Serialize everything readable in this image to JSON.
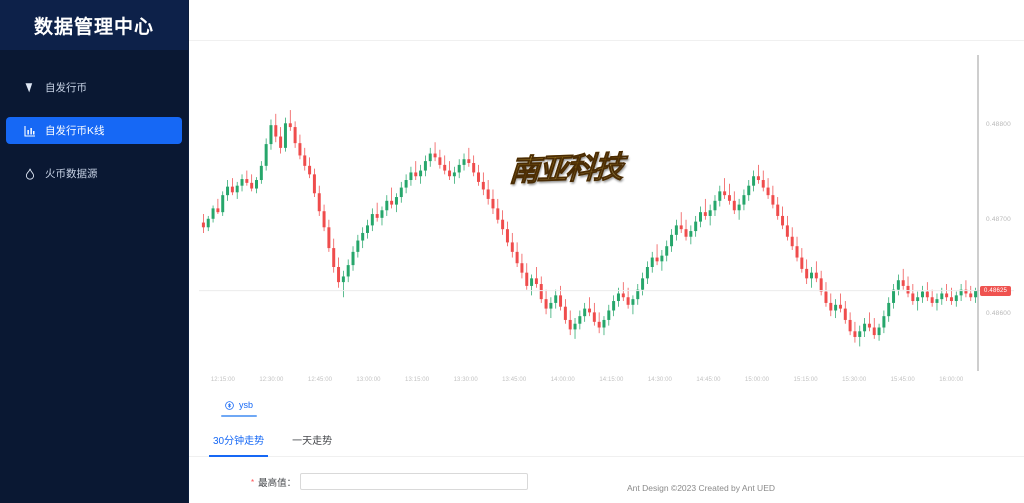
{
  "sidebar": {
    "title": "数据管理中心",
    "items": [
      {
        "label": "自发行币",
        "icon": "tag-icon",
        "active": false
      },
      {
        "label": "自发行币K线",
        "icon": "line-chart-icon",
        "active": true
      },
      {
        "label": "火币数据源",
        "icon": "fire-icon",
        "active": false
      }
    ]
  },
  "chart": {
    "watermark": "南亚科技",
    "current_price_tag": "0.48625",
    "y_labels": [
      "0.48800",
      "0.48700",
      "0.48600"
    ],
    "x_labels": [
      "12:15:00",
      "12:30:00",
      "12:45:00",
      "13:00:00",
      "13:15:00",
      "13:30:00",
      "13:45:00",
      "14:00:00",
      "14:15:00",
      "14:30:00",
      "14:45:00",
      "15:00:00",
      "15:15:00",
      "15:30:00",
      "15:45:00",
      "16:00:00"
    ]
  },
  "chart_data": {
    "type": "candlestick",
    "title": "",
    "xlabel": "",
    "ylabel": "",
    "ylim": [
      0.4854,
      0.4887
    ],
    "xlim": [
      "12:15:00",
      "16:12:00"
    ],
    "grid": false,
    "legend": "none",
    "up_color": "#26a66b",
    "down_color": "#ef4c4c",
    "y_ticks": [
      0.488,
      0.487,
      0.486
    ],
    "x_ticks": [
      "12:15:00",
      "12:30:00",
      "12:45:00",
      "13:00:00",
      "13:15:00",
      "13:30:00",
      "13:45:00",
      "14:00:00",
      "14:15:00",
      "14:30:00",
      "14:45:00",
      "15:00:00",
      "15:15:00",
      "15:30:00",
      "15:45:00",
      "16:00:00"
    ],
    "marker_price": 0.48625,
    "candles": [
      {
        "o": 0.48697,
        "h": 0.48706,
        "l": 0.48686,
        "c": 0.48692
      },
      {
        "o": 0.48692,
        "h": 0.48704,
        "l": 0.48688,
        "c": 0.48701
      },
      {
        "o": 0.48701,
        "h": 0.48715,
        "l": 0.48697,
        "c": 0.48712
      },
      {
        "o": 0.48712,
        "h": 0.48722,
        "l": 0.48706,
        "c": 0.48708
      },
      {
        "o": 0.48708,
        "h": 0.4873,
        "l": 0.48704,
        "c": 0.48726
      },
      {
        "o": 0.48726,
        "h": 0.48742,
        "l": 0.4872,
        "c": 0.48735
      },
      {
        "o": 0.48735,
        "h": 0.48744,
        "l": 0.48726,
        "c": 0.48729
      },
      {
        "o": 0.48729,
        "h": 0.4874,
        "l": 0.48722,
        "c": 0.48736
      },
      {
        "o": 0.48736,
        "h": 0.48748,
        "l": 0.4873,
        "c": 0.48743
      },
      {
        "o": 0.48743,
        "h": 0.48752,
        "l": 0.48736,
        "c": 0.48739
      },
      {
        "o": 0.48739,
        "h": 0.48748,
        "l": 0.4873,
        "c": 0.48733
      },
      {
        "o": 0.48733,
        "h": 0.48745,
        "l": 0.48728,
        "c": 0.48742
      },
      {
        "o": 0.48742,
        "h": 0.48762,
        "l": 0.48738,
        "c": 0.48757
      },
      {
        "o": 0.48757,
        "h": 0.48786,
        "l": 0.48752,
        "c": 0.4878
      },
      {
        "o": 0.4878,
        "h": 0.48806,
        "l": 0.48774,
        "c": 0.488
      },
      {
        "o": 0.488,
        "h": 0.48812,
        "l": 0.48782,
        "c": 0.48788
      },
      {
        "o": 0.48788,
        "h": 0.48798,
        "l": 0.4877,
        "c": 0.48776
      },
      {
        "o": 0.48776,
        "h": 0.48808,
        "l": 0.48772,
        "c": 0.48802
      },
      {
        "o": 0.48802,
        "h": 0.48816,
        "l": 0.48794,
        "c": 0.48798
      },
      {
        "o": 0.48798,
        "h": 0.48804,
        "l": 0.48776,
        "c": 0.48781
      },
      {
        "o": 0.48781,
        "h": 0.4879,
        "l": 0.48764,
        "c": 0.48768
      },
      {
        "o": 0.48768,
        "h": 0.48776,
        "l": 0.48752,
        "c": 0.48757
      },
      {
        "o": 0.48757,
        "h": 0.48766,
        "l": 0.48744,
        "c": 0.48748
      },
      {
        "o": 0.48748,
        "h": 0.48754,
        "l": 0.48724,
        "c": 0.48728
      },
      {
        "o": 0.48728,
        "h": 0.48736,
        "l": 0.48704,
        "c": 0.48709
      },
      {
        "o": 0.48709,
        "h": 0.48716,
        "l": 0.48688,
        "c": 0.48692
      },
      {
        "o": 0.48692,
        "h": 0.487,
        "l": 0.48666,
        "c": 0.4867
      },
      {
        "o": 0.4867,
        "h": 0.4868,
        "l": 0.48644,
        "c": 0.4865
      },
      {
        "o": 0.4865,
        "h": 0.4866,
        "l": 0.48628,
        "c": 0.48634
      },
      {
        "o": 0.48634,
        "h": 0.48646,
        "l": 0.48618,
        "c": 0.4864
      },
      {
        "o": 0.4864,
        "h": 0.48658,
        "l": 0.48634,
        "c": 0.48652
      },
      {
        "o": 0.48652,
        "h": 0.48672,
        "l": 0.48646,
        "c": 0.48666
      },
      {
        "o": 0.48666,
        "h": 0.48684,
        "l": 0.4866,
        "c": 0.48678
      },
      {
        "o": 0.48678,
        "h": 0.48692,
        "l": 0.4867,
        "c": 0.48686
      },
      {
        "o": 0.48686,
        "h": 0.487,
        "l": 0.4868,
        "c": 0.48694
      },
      {
        "o": 0.48694,
        "h": 0.48712,
        "l": 0.48688,
        "c": 0.48706
      },
      {
        "o": 0.48706,
        "h": 0.48718,
        "l": 0.48698,
        "c": 0.48702
      },
      {
        "o": 0.48702,
        "h": 0.48714,
        "l": 0.48694,
        "c": 0.4871
      },
      {
        "o": 0.4871,
        "h": 0.48726,
        "l": 0.48704,
        "c": 0.4872
      },
      {
        "o": 0.4872,
        "h": 0.48734,
        "l": 0.48712,
        "c": 0.48716
      },
      {
        "o": 0.48716,
        "h": 0.48728,
        "l": 0.48708,
        "c": 0.48724
      },
      {
        "o": 0.48724,
        "h": 0.4874,
        "l": 0.48718,
        "c": 0.48734
      },
      {
        "o": 0.48734,
        "h": 0.48748,
        "l": 0.48728,
        "c": 0.48742
      },
      {
        "o": 0.48742,
        "h": 0.48756,
        "l": 0.48736,
        "c": 0.4875
      },
      {
        "o": 0.4875,
        "h": 0.48762,
        "l": 0.48742,
        "c": 0.48746
      },
      {
        "o": 0.48746,
        "h": 0.48758,
        "l": 0.48738,
        "c": 0.48752
      },
      {
        "o": 0.48752,
        "h": 0.48768,
        "l": 0.48746,
        "c": 0.48762
      },
      {
        "o": 0.48762,
        "h": 0.48776,
        "l": 0.48756,
        "c": 0.4877
      },
      {
        "o": 0.4877,
        "h": 0.48782,
        "l": 0.48762,
        "c": 0.48766
      },
      {
        "o": 0.48766,
        "h": 0.48774,
        "l": 0.48754,
        "c": 0.48758
      },
      {
        "o": 0.48758,
        "h": 0.48768,
        "l": 0.48748,
        "c": 0.48752
      },
      {
        "o": 0.48752,
        "h": 0.48762,
        "l": 0.48742,
        "c": 0.48746
      },
      {
        "o": 0.48746,
        "h": 0.48756,
        "l": 0.48738,
        "c": 0.4875
      },
      {
        "o": 0.4875,
        "h": 0.48764,
        "l": 0.48744,
        "c": 0.48758
      },
      {
        "o": 0.48758,
        "h": 0.4877,
        "l": 0.48752,
        "c": 0.48764
      },
      {
        "o": 0.48764,
        "h": 0.48776,
        "l": 0.48756,
        "c": 0.4876
      },
      {
        "o": 0.4876,
        "h": 0.48768,
        "l": 0.48746,
        "c": 0.4875
      },
      {
        "o": 0.4875,
        "h": 0.48758,
        "l": 0.48736,
        "c": 0.4874
      },
      {
        "o": 0.4874,
        "h": 0.4875,
        "l": 0.48726,
        "c": 0.48732
      },
      {
        "o": 0.48732,
        "h": 0.48742,
        "l": 0.48716,
        "c": 0.48722
      },
      {
        "o": 0.48722,
        "h": 0.48732,
        "l": 0.48706,
        "c": 0.48712
      },
      {
        "o": 0.48712,
        "h": 0.48722,
        "l": 0.48696,
        "c": 0.487
      },
      {
        "o": 0.487,
        "h": 0.4871,
        "l": 0.48684,
        "c": 0.4869
      },
      {
        "o": 0.4869,
        "h": 0.48698,
        "l": 0.48672,
        "c": 0.48676
      },
      {
        "o": 0.48676,
        "h": 0.48686,
        "l": 0.4866,
        "c": 0.48666
      },
      {
        "o": 0.48666,
        "h": 0.48676,
        "l": 0.4865,
        "c": 0.48654
      },
      {
        "o": 0.48654,
        "h": 0.48664,
        "l": 0.48638,
        "c": 0.48644
      },
      {
        "o": 0.48644,
        "h": 0.48654,
        "l": 0.48626,
        "c": 0.4863
      },
      {
        "o": 0.4863,
        "h": 0.48642,
        "l": 0.4862,
        "c": 0.48638
      },
      {
        "o": 0.48638,
        "h": 0.4865,
        "l": 0.48628,
        "c": 0.48632
      },
      {
        "o": 0.48632,
        "h": 0.4864,
        "l": 0.48612,
        "c": 0.48616
      },
      {
        "o": 0.48616,
        "h": 0.48626,
        "l": 0.486,
        "c": 0.48606
      },
      {
        "o": 0.48606,
        "h": 0.48618,
        "l": 0.48596,
        "c": 0.48612
      },
      {
        "o": 0.48612,
        "h": 0.48626,
        "l": 0.48606,
        "c": 0.4862
      },
      {
        "o": 0.4862,
        "h": 0.4863,
        "l": 0.48604,
        "c": 0.48608
      },
      {
        "o": 0.48608,
        "h": 0.48616,
        "l": 0.4859,
        "c": 0.48594
      },
      {
        "o": 0.48594,
        "h": 0.48604,
        "l": 0.48578,
        "c": 0.48584
      },
      {
        "o": 0.48584,
        "h": 0.48596,
        "l": 0.48574,
        "c": 0.4859
      },
      {
        "o": 0.4859,
        "h": 0.48604,
        "l": 0.48584,
        "c": 0.48598
      },
      {
        "o": 0.48598,
        "h": 0.48612,
        "l": 0.48592,
        "c": 0.48606
      },
      {
        "o": 0.48606,
        "h": 0.48618,
        "l": 0.48598,
        "c": 0.48602
      },
      {
        "o": 0.48602,
        "h": 0.48612,
        "l": 0.48588,
        "c": 0.48592
      },
      {
        "o": 0.48592,
        "h": 0.48602,
        "l": 0.4858,
        "c": 0.48586
      },
      {
        "o": 0.48586,
        "h": 0.48598,
        "l": 0.48578,
        "c": 0.48594
      },
      {
        "o": 0.48594,
        "h": 0.4861,
        "l": 0.48588,
        "c": 0.48604
      },
      {
        "o": 0.48604,
        "h": 0.4862,
        "l": 0.48598,
        "c": 0.48614
      },
      {
        "o": 0.48614,
        "h": 0.48628,
        "l": 0.48608,
        "c": 0.48622
      },
      {
        "o": 0.48622,
        "h": 0.48634,
        "l": 0.48614,
        "c": 0.48618
      },
      {
        "o": 0.48618,
        "h": 0.48628,
        "l": 0.48606,
        "c": 0.4861
      },
      {
        "o": 0.4861,
        "h": 0.4862,
        "l": 0.486,
        "c": 0.48616
      },
      {
        "o": 0.48616,
        "h": 0.48632,
        "l": 0.4861,
        "c": 0.48626
      },
      {
        "o": 0.48626,
        "h": 0.48644,
        "l": 0.4862,
        "c": 0.48638
      },
      {
        "o": 0.48638,
        "h": 0.48656,
        "l": 0.48632,
        "c": 0.4865
      },
      {
        "o": 0.4865,
        "h": 0.48666,
        "l": 0.48644,
        "c": 0.4866
      },
      {
        "o": 0.4866,
        "h": 0.48674,
        "l": 0.48652,
        "c": 0.48656
      },
      {
        "o": 0.48656,
        "h": 0.48668,
        "l": 0.48646,
        "c": 0.48662
      },
      {
        "o": 0.48662,
        "h": 0.48678,
        "l": 0.48656,
        "c": 0.48672
      },
      {
        "o": 0.48672,
        "h": 0.4869,
        "l": 0.48666,
        "c": 0.48684
      },
      {
        "o": 0.48684,
        "h": 0.487,
        "l": 0.48678,
        "c": 0.48694
      },
      {
        "o": 0.48694,
        "h": 0.48708,
        "l": 0.48686,
        "c": 0.4869
      },
      {
        "o": 0.4869,
        "h": 0.487,
        "l": 0.48678,
        "c": 0.48682
      },
      {
        "o": 0.48682,
        "h": 0.48694,
        "l": 0.48674,
        "c": 0.48688
      },
      {
        "o": 0.48688,
        "h": 0.48704,
        "l": 0.48682,
        "c": 0.48698
      },
      {
        "o": 0.48698,
        "h": 0.48714,
        "l": 0.48692,
        "c": 0.48708
      },
      {
        "o": 0.48708,
        "h": 0.48722,
        "l": 0.487,
        "c": 0.48704
      },
      {
        "o": 0.48704,
        "h": 0.48716,
        "l": 0.48694,
        "c": 0.4871
      },
      {
        "o": 0.4871,
        "h": 0.48726,
        "l": 0.48704,
        "c": 0.4872
      },
      {
        "o": 0.4872,
        "h": 0.48736,
        "l": 0.48714,
        "c": 0.4873
      },
      {
        "o": 0.4873,
        "h": 0.48744,
        "l": 0.48722,
        "c": 0.48726
      },
      {
        "o": 0.48726,
        "h": 0.48738,
        "l": 0.48716,
        "c": 0.4872
      },
      {
        "o": 0.4872,
        "h": 0.4873,
        "l": 0.48706,
        "c": 0.4871
      },
      {
        "o": 0.4871,
        "h": 0.48722,
        "l": 0.487,
        "c": 0.48716
      },
      {
        "o": 0.48716,
        "h": 0.48732,
        "l": 0.4871,
        "c": 0.48726
      },
      {
        "o": 0.48726,
        "h": 0.48742,
        "l": 0.4872,
        "c": 0.48736
      },
      {
        "o": 0.48736,
        "h": 0.48752,
        "l": 0.4873,
        "c": 0.48746
      },
      {
        "o": 0.48746,
        "h": 0.48758,
        "l": 0.48738,
        "c": 0.48742
      },
      {
        "o": 0.48742,
        "h": 0.48752,
        "l": 0.4873,
        "c": 0.48734
      },
      {
        "o": 0.48734,
        "h": 0.48744,
        "l": 0.48722,
        "c": 0.48726
      },
      {
        "o": 0.48726,
        "h": 0.48736,
        "l": 0.48712,
        "c": 0.48716
      },
      {
        "o": 0.48716,
        "h": 0.48724,
        "l": 0.487,
        "c": 0.48704
      },
      {
        "o": 0.48704,
        "h": 0.48714,
        "l": 0.4869,
        "c": 0.48694
      },
      {
        "o": 0.48694,
        "h": 0.48704,
        "l": 0.48678,
        "c": 0.48682
      },
      {
        "o": 0.48682,
        "h": 0.48692,
        "l": 0.48668,
        "c": 0.48672
      },
      {
        "o": 0.48672,
        "h": 0.48682,
        "l": 0.48656,
        "c": 0.4866
      },
      {
        "o": 0.4866,
        "h": 0.4867,
        "l": 0.48644,
        "c": 0.48648
      },
      {
        "o": 0.48648,
        "h": 0.48658,
        "l": 0.48632,
        "c": 0.48638
      },
      {
        "o": 0.48638,
        "h": 0.4865,
        "l": 0.48628,
        "c": 0.48644
      },
      {
        "o": 0.48644,
        "h": 0.48656,
        "l": 0.48634,
        "c": 0.48638
      },
      {
        "o": 0.48638,
        "h": 0.48646,
        "l": 0.4862,
        "c": 0.48624
      },
      {
        "o": 0.48624,
        "h": 0.48634,
        "l": 0.48608,
        "c": 0.48612
      },
      {
        "o": 0.48612,
        "h": 0.48622,
        "l": 0.48598,
        "c": 0.48604
      },
      {
        "o": 0.48604,
        "h": 0.48616,
        "l": 0.48596,
        "c": 0.4861
      },
      {
        "o": 0.4861,
        "h": 0.48622,
        "l": 0.48602,
        "c": 0.48606
      },
      {
        "o": 0.48606,
        "h": 0.48614,
        "l": 0.4859,
        "c": 0.48594
      },
      {
        "o": 0.48594,
        "h": 0.48602,
        "l": 0.48578,
        "c": 0.48582
      },
      {
        "o": 0.48582,
        "h": 0.48592,
        "l": 0.4857,
        "c": 0.48576
      },
      {
        "o": 0.48576,
        "h": 0.48588,
        "l": 0.48566,
        "c": 0.48582
      },
      {
        "o": 0.48582,
        "h": 0.48596,
        "l": 0.48576,
        "c": 0.4859
      },
      {
        "o": 0.4859,
        "h": 0.48602,
        "l": 0.48582,
        "c": 0.48586
      },
      {
        "o": 0.48586,
        "h": 0.48596,
        "l": 0.48574,
        "c": 0.48578
      },
      {
        "o": 0.48578,
        "h": 0.4859,
        "l": 0.48572,
        "c": 0.48586
      },
      {
        "o": 0.48586,
        "h": 0.48604,
        "l": 0.4858,
        "c": 0.48598
      },
      {
        "o": 0.48598,
        "h": 0.48618,
        "l": 0.48592,
        "c": 0.48612
      },
      {
        "o": 0.48612,
        "h": 0.48632,
        "l": 0.48606,
        "c": 0.48626
      },
      {
        "o": 0.48626,
        "h": 0.48642,
        "l": 0.4862,
        "c": 0.48636
      },
      {
        "o": 0.48636,
        "h": 0.48648,
        "l": 0.48626,
        "c": 0.4863
      },
      {
        "o": 0.4863,
        "h": 0.4864,
        "l": 0.48618,
        "c": 0.48622
      },
      {
        "o": 0.48622,
        "h": 0.48632,
        "l": 0.4861,
        "c": 0.48614
      },
      {
        "o": 0.48614,
        "h": 0.48624,
        "l": 0.48604,
        "c": 0.48618
      },
      {
        "o": 0.48618,
        "h": 0.4863,
        "l": 0.48612,
        "c": 0.48624
      },
      {
        "o": 0.48624,
        "h": 0.48634,
        "l": 0.48614,
        "c": 0.48618
      },
      {
        "o": 0.48618,
        "h": 0.48626,
        "l": 0.48608,
        "c": 0.48612
      },
      {
        "o": 0.48612,
        "h": 0.48622,
        "l": 0.48604,
        "c": 0.48616
      },
      {
        "o": 0.48616,
        "h": 0.48628,
        "l": 0.4861,
        "c": 0.48622
      },
      {
        "o": 0.48622,
        "h": 0.48632,
        "l": 0.48614,
        "c": 0.48618
      },
      {
        "o": 0.48618,
        "h": 0.48628,
        "l": 0.4861,
        "c": 0.48614
      },
      {
        "o": 0.48614,
        "h": 0.48624,
        "l": 0.48608,
        "c": 0.4862
      },
      {
        "o": 0.4862,
        "h": 0.48632,
        "l": 0.48614,
        "c": 0.48626
      },
      {
        "o": 0.48626,
        "h": 0.48636,
        "l": 0.48618,
        "c": 0.48622
      },
      {
        "o": 0.48622,
        "h": 0.4863,
        "l": 0.48614,
        "c": 0.48618
      },
      {
        "o": 0.48618,
        "h": 0.48628,
        "l": 0.48612,
        "c": 0.48625
      }
    ]
  },
  "tabs": {
    "coin": [
      {
        "label": "ysb",
        "icon": "coin-icon",
        "active": true
      }
    ],
    "range": [
      {
        "label": "30分钟走势",
        "active": true
      },
      {
        "label": "一天走势",
        "active": false
      }
    ]
  },
  "form": {
    "required_mark": "*",
    "label": "最高值：",
    "value": "",
    "placeholder": ""
  },
  "footer": {
    "text": "Ant Design ©2023 Created by Ant UED"
  },
  "colors": {
    "sidebar_bg": "#0a1833",
    "sidebar_header_bg": "#0d2149",
    "accent": "#1668f5",
    "up": "#26a66b",
    "down": "#ef4c4c",
    "tag": "#ef5350"
  }
}
